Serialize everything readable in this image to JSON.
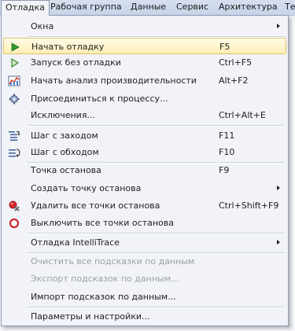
{
  "menubar": {
    "items": [
      {
        "label": "Отладка"
      },
      {
        "label": "Рабочая группа"
      },
      {
        "label": "Данные"
      },
      {
        "label": "Сервис"
      },
      {
        "label": "Архитектура"
      },
      {
        "label": "Те"
      }
    ]
  },
  "menu": {
    "items": [
      {
        "label": "Окна",
        "shortcut": "",
        "icon": "",
        "submenu": true
      },
      {
        "label": "Начать отладку",
        "shortcut": "F5",
        "icon": "play-icon",
        "highlighted": true
      },
      {
        "label": "Запуск без отладки",
        "shortcut": "Ctrl+F5",
        "icon": "play-outline-icon"
      },
      {
        "label": "Начать анализ производительности",
        "shortcut": "Alt+F2",
        "icon": "performance-chart-icon"
      },
      {
        "label": "Присоединиться к процессу...",
        "shortcut": "",
        "icon": "attach-process-icon"
      },
      {
        "label": "Исключения...",
        "shortcut": "Ctrl+Alt+E",
        "icon": ""
      },
      {
        "label": "Шаг с заходом",
        "shortcut": "F11",
        "icon": "step-into-icon"
      },
      {
        "label": "Шаг с обходом",
        "shortcut": "F10",
        "icon": "step-over-icon"
      },
      {
        "label": "Точка останова",
        "shortcut": "F9",
        "icon": ""
      },
      {
        "label": "Создать точку останова",
        "shortcut": "",
        "icon": "",
        "submenu": true
      },
      {
        "label": "Удалить все точки останова",
        "shortcut": "Ctrl+Shift+F9",
        "icon": "delete-breakpoints-icon"
      },
      {
        "label": "Выключить все точки останова",
        "shortcut": "",
        "icon": "disable-breakpoints-icon"
      },
      {
        "label": "Отладка IntelliTrace",
        "shortcut": "",
        "icon": "",
        "submenu": true
      },
      {
        "label": "Очистить все подсказки по данным",
        "shortcut": "",
        "icon": "",
        "disabled": true
      },
      {
        "label": "Экспорт подсказок по данным...",
        "shortcut": "",
        "icon": "",
        "disabled": true
      },
      {
        "label": "Импорт подсказок по данным...",
        "shortcut": "",
        "icon": ""
      },
      {
        "label": "Параметры и настройки...",
        "shortcut": "",
        "icon": ""
      }
    ]
  },
  "colors": {
    "highlight": "#ffeeb4",
    "menu_bg": "#f1f3f8",
    "disabled_text": "#9aa0a8"
  }
}
